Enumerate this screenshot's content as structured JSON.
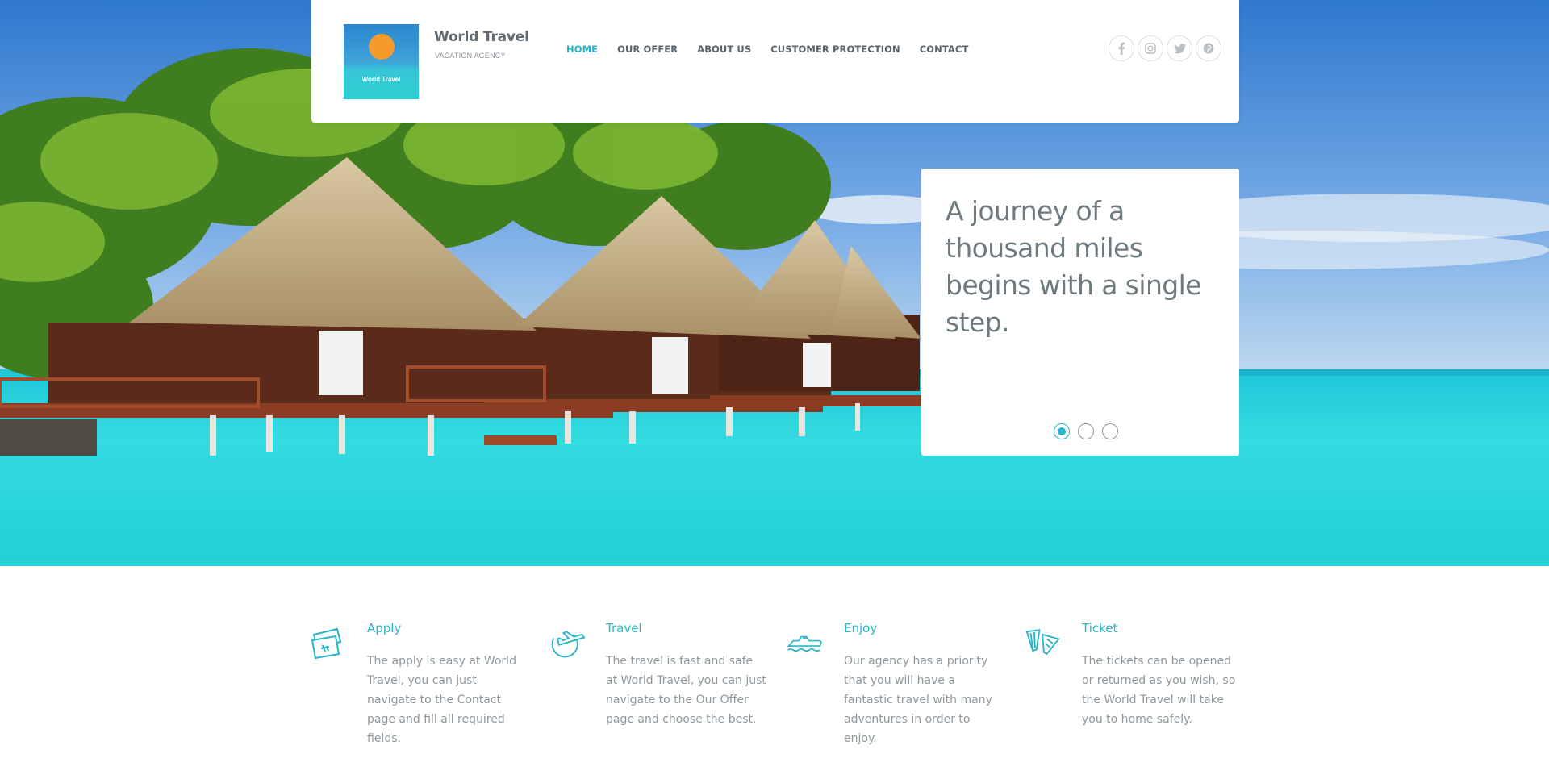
{
  "header": {
    "logo_text": "World Travel",
    "brand_name": "World Travel",
    "brand_tagline": "VACATION AGENCY",
    "nav": [
      {
        "label": "HOME",
        "active": true
      },
      {
        "label": "OUR OFFER",
        "active": false
      },
      {
        "label": "ABOUT US",
        "active": false
      },
      {
        "label": "CUSTOMER PROTECTION",
        "active": false
      },
      {
        "label": "CONTACT",
        "active": false
      }
    ],
    "social": [
      {
        "icon": "facebook-icon",
        "glyph": "f"
      },
      {
        "icon": "instagram-icon",
        "glyph": "◙"
      },
      {
        "icon": "twitter-icon",
        "glyph": "t"
      },
      {
        "icon": "pinterest-icon",
        "glyph": "p"
      }
    ]
  },
  "hero": {
    "quote": "A journey of a thousand miles begins with a single step.",
    "slides": 3,
    "active_slide": 1
  },
  "features": [
    {
      "icon": "ticket-icon",
      "title": "Apply",
      "text": "The apply is easy at World Travel, you can just navigate to the Contact page and fill all required fields."
    },
    {
      "icon": "plane-icon",
      "title": "Travel",
      "text": "The travel is fast and safe at World Travel, you can just navigate to the Our Offer page and choose the best."
    },
    {
      "icon": "boat-icon",
      "title": "Enjoy",
      "text": "Our agency has a priority that you will have a fantastic travel with many adventures in order to enjoy."
    },
    {
      "icon": "flippers-icon",
      "title": "Ticket",
      "text": "The tickets can be opened or returned as you wish, so the World Travel will take you to home safely."
    }
  ],
  "colors": {
    "accent": "#26b5c9",
    "text_muted": "#8f989d",
    "sea": "#2fd6dc"
  }
}
